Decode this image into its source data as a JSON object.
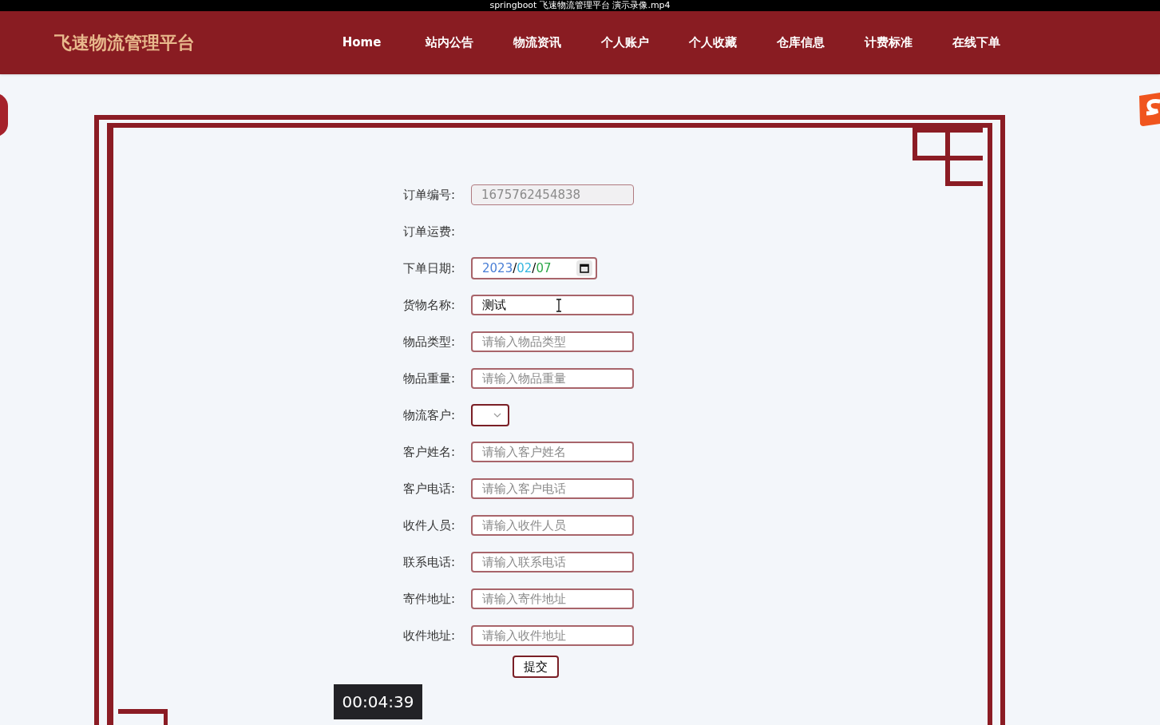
{
  "player": {
    "title": "springboot 飞速物流管理平台 演示录像.mp4",
    "timestamp": "00:04:39"
  },
  "nav": {
    "brand": "飞速物流管理平台",
    "items": [
      {
        "label": "Home"
      },
      {
        "label": "站内公告"
      },
      {
        "label": "物流资讯"
      },
      {
        "label": "个人账户"
      },
      {
        "label": "个人收藏"
      },
      {
        "label": "仓库信息"
      },
      {
        "label": "计费标准"
      },
      {
        "label": "在线下单"
      }
    ]
  },
  "form": {
    "fields": [
      {
        "label": "订单编号:",
        "kind": "readonly",
        "value": "1675762454838"
      },
      {
        "label": "订单运费:",
        "kind": "empty"
      },
      {
        "label": "下单日期:",
        "kind": "date",
        "parts": [
          "2023",
          "02",
          "07"
        ],
        "separator": "/"
      },
      {
        "label": "货物名称:",
        "kind": "input",
        "value": "测试"
      },
      {
        "label": "物品类型:",
        "kind": "input",
        "placeholder": "请输入物品类型"
      },
      {
        "label": "物品重量:",
        "kind": "input",
        "placeholder": "请输入物品重量"
      },
      {
        "label": "物流客户:",
        "kind": "select"
      },
      {
        "label": "客户姓名:",
        "kind": "input",
        "placeholder": "请输入客户姓名"
      },
      {
        "label": "客户电话:",
        "kind": "input",
        "placeholder": "请输入客户电话"
      },
      {
        "label": "收件人员:",
        "kind": "input",
        "placeholder": "请输入收件人员"
      },
      {
        "label": "联系电话:",
        "kind": "input",
        "placeholder": "请输入联系电话"
      },
      {
        "label": "寄件地址:",
        "kind": "input",
        "placeholder": "请输入寄件地址"
      },
      {
        "label": "收件地址:",
        "kind": "input",
        "placeholder": "请输入收件地址"
      }
    ],
    "submit": "提交"
  }
}
